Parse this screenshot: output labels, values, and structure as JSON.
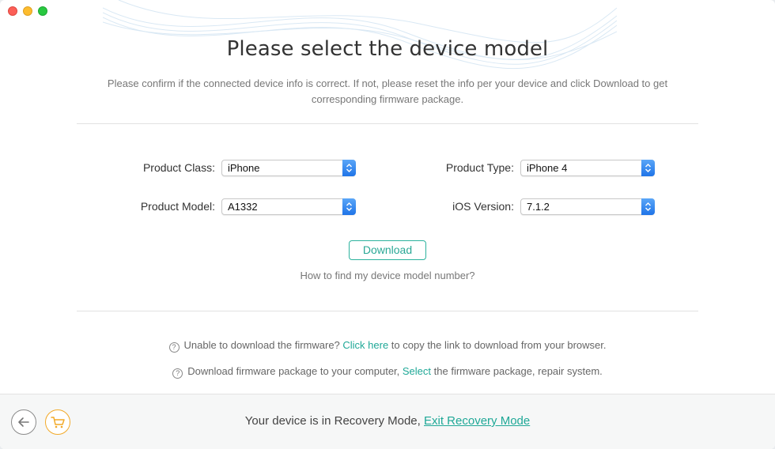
{
  "window": {
    "controls": [
      "close",
      "minimize",
      "maximize"
    ]
  },
  "header": {
    "title": "Please select the device model",
    "subtitle": "Please confirm if the connected device info is correct. If not, please reset the info per your device and click Download to get corresponding firmware package."
  },
  "form": {
    "product_class": {
      "label": "Product Class:",
      "value": "iPhone"
    },
    "product_type": {
      "label": "Product Type:",
      "value": "iPhone 4"
    },
    "product_model": {
      "label": "Product Model:",
      "value": "A1332"
    },
    "ios_version": {
      "label": "iOS Version:",
      "value": "7.1.2"
    }
  },
  "actions": {
    "download_label": "Download",
    "howto_text": "How to find my device model number?"
  },
  "help": {
    "line1_pre": "Unable to download the firmware? ",
    "line1_link": "Click here",
    "line1_post": " to copy the link to download from your browser.",
    "line2_pre": "Download firmware package to your computer, ",
    "line2_link": "Select",
    "line2_post": " the firmware package, repair system.",
    "icon_glyph": "?"
  },
  "footer": {
    "status_text": "Your device is in Recovery Mode, ",
    "exit_link": "Exit Recovery Mode",
    "back_icon": "back-arrow-icon",
    "cart_icon": "cart-icon"
  },
  "colors": {
    "accent": "#2aa896",
    "select_button": "#1f74e8",
    "cart": "#f2a927"
  }
}
